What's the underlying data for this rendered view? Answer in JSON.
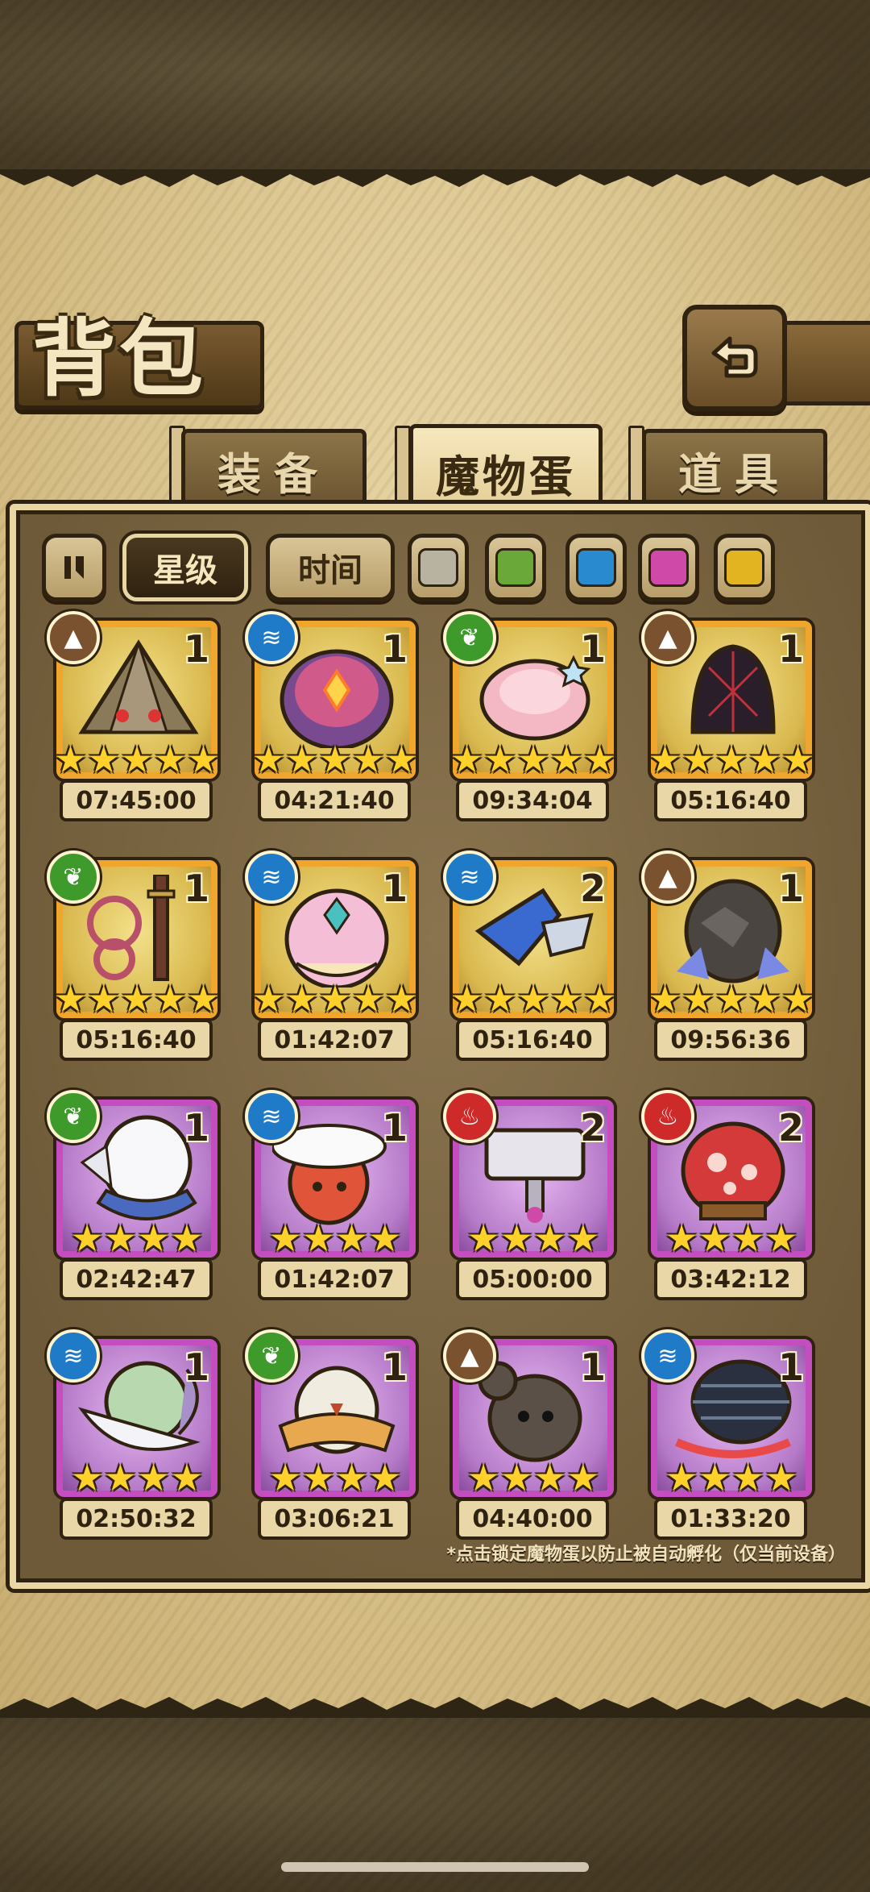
{
  "page": {
    "title": "背包",
    "hint": "*点击锁定魔物蛋以防止被自动孵化（仅当前设备）"
  },
  "tabs": [
    {
      "label": "装备",
      "active": false
    },
    {
      "label": "魔物蛋",
      "active": true
    },
    {
      "label": "道具",
      "active": false
    }
  ],
  "filters": {
    "sort_star_label": "星级",
    "sort_time_label": "时间",
    "colors": [
      "#b8b2a0",
      "#6aa83a",
      "#2a8ad0",
      "#cf4aa8",
      "#e3b422"
    ]
  },
  "colors": {
    "gold_frame": "#f0a52c",
    "purple_frame": "#c44ec0",
    "earth": "#7a5230",
    "water": "#1f7ac8",
    "plant": "#3f9a2c",
    "fire": "#cf2a2a"
  },
  "eggs": [
    {
      "element": "earth",
      "count": "1",
      "stars": "★★★★★",
      "timer": "07:45:00",
      "rarity": "gold",
      "art": "pyramid"
    },
    {
      "element": "water",
      "count": "1",
      "stars": "★★★★★",
      "timer": "04:21:40",
      "rarity": "gold",
      "art": "orb-egg"
    },
    {
      "element": "plant",
      "count": "1",
      "stars": "★★★★★",
      "timer": "09:34:04",
      "rarity": "gold",
      "art": "pink-egg"
    },
    {
      "element": "earth",
      "count": "1",
      "stars": "★★★★★",
      "timer": "05:16:40",
      "rarity": "gold",
      "art": "dark-egg"
    },
    {
      "element": "plant",
      "count": "1",
      "stars": "★★★★★",
      "timer": "05:16:40",
      "rarity": "gold",
      "art": "sword"
    },
    {
      "element": "water",
      "count": "1",
      "stars": "★★★★★",
      "timer": "01:42:07",
      "rarity": "gold",
      "art": "gem-egg"
    },
    {
      "element": "water",
      "count": "2",
      "stars": "★★★★★",
      "timer": "05:16:40",
      "rarity": "gold",
      "art": "blue-blade"
    },
    {
      "element": "earth",
      "count": "1",
      "stars": "★★★★★",
      "timer": "09:56:36",
      "rarity": "gold",
      "art": "rock-egg"
    },
    {
      "element": "plant",
      "count": "1",
      "stars": "★★★★",
      "timer": "02:42:47",
      "rarity": "purple",
      "art": "white-egg"
    },
    {
      "element": "water",
      "count": "1",
      "stars": "★★★★",
      "timer": "01:42:07",
      "rarity": "purple",
      "art": "feather-egg"
    },
    {
      "element": "fire",
      "count": "2",
      "stars": "★★★★",
      "timer": "05:00:00",
      "rarity": "purple",
      "art": "hammer"
    },
    {
      "element": "fire",
      "count": "2",
      "stars": "★★★★",
      "timer": "03:42:12",
      "rarity": "purple",
      "art": "spotted-egg"
    },
    {
      "element": "water",
      "count": "1",
      "stars": "★★★★",
      "timer": "02:50:32",
      "rarity": "purple",
      "art": "leaf-egg"
    },
    {
      "element": "plant",
      "count": "1",
      "stars": "★★★★",
      "timer": "03:06:21",
      "rarity": "purple",
      "art": "bird-egg"
    },
    {
      "element": "earth",
      "count": "1",
      "stars": "★★★★",
      "timer": "04:40:00",
      "rarity": "purple",
      "art": "mouse-egg"
    },
    {
      "element": "water",
      "count": "1",
      "stars": "★★★★",
      "timer": "01:33:20",
      "rarity": "purple",
      "art": "shell-egg"
    }
  ]
}
